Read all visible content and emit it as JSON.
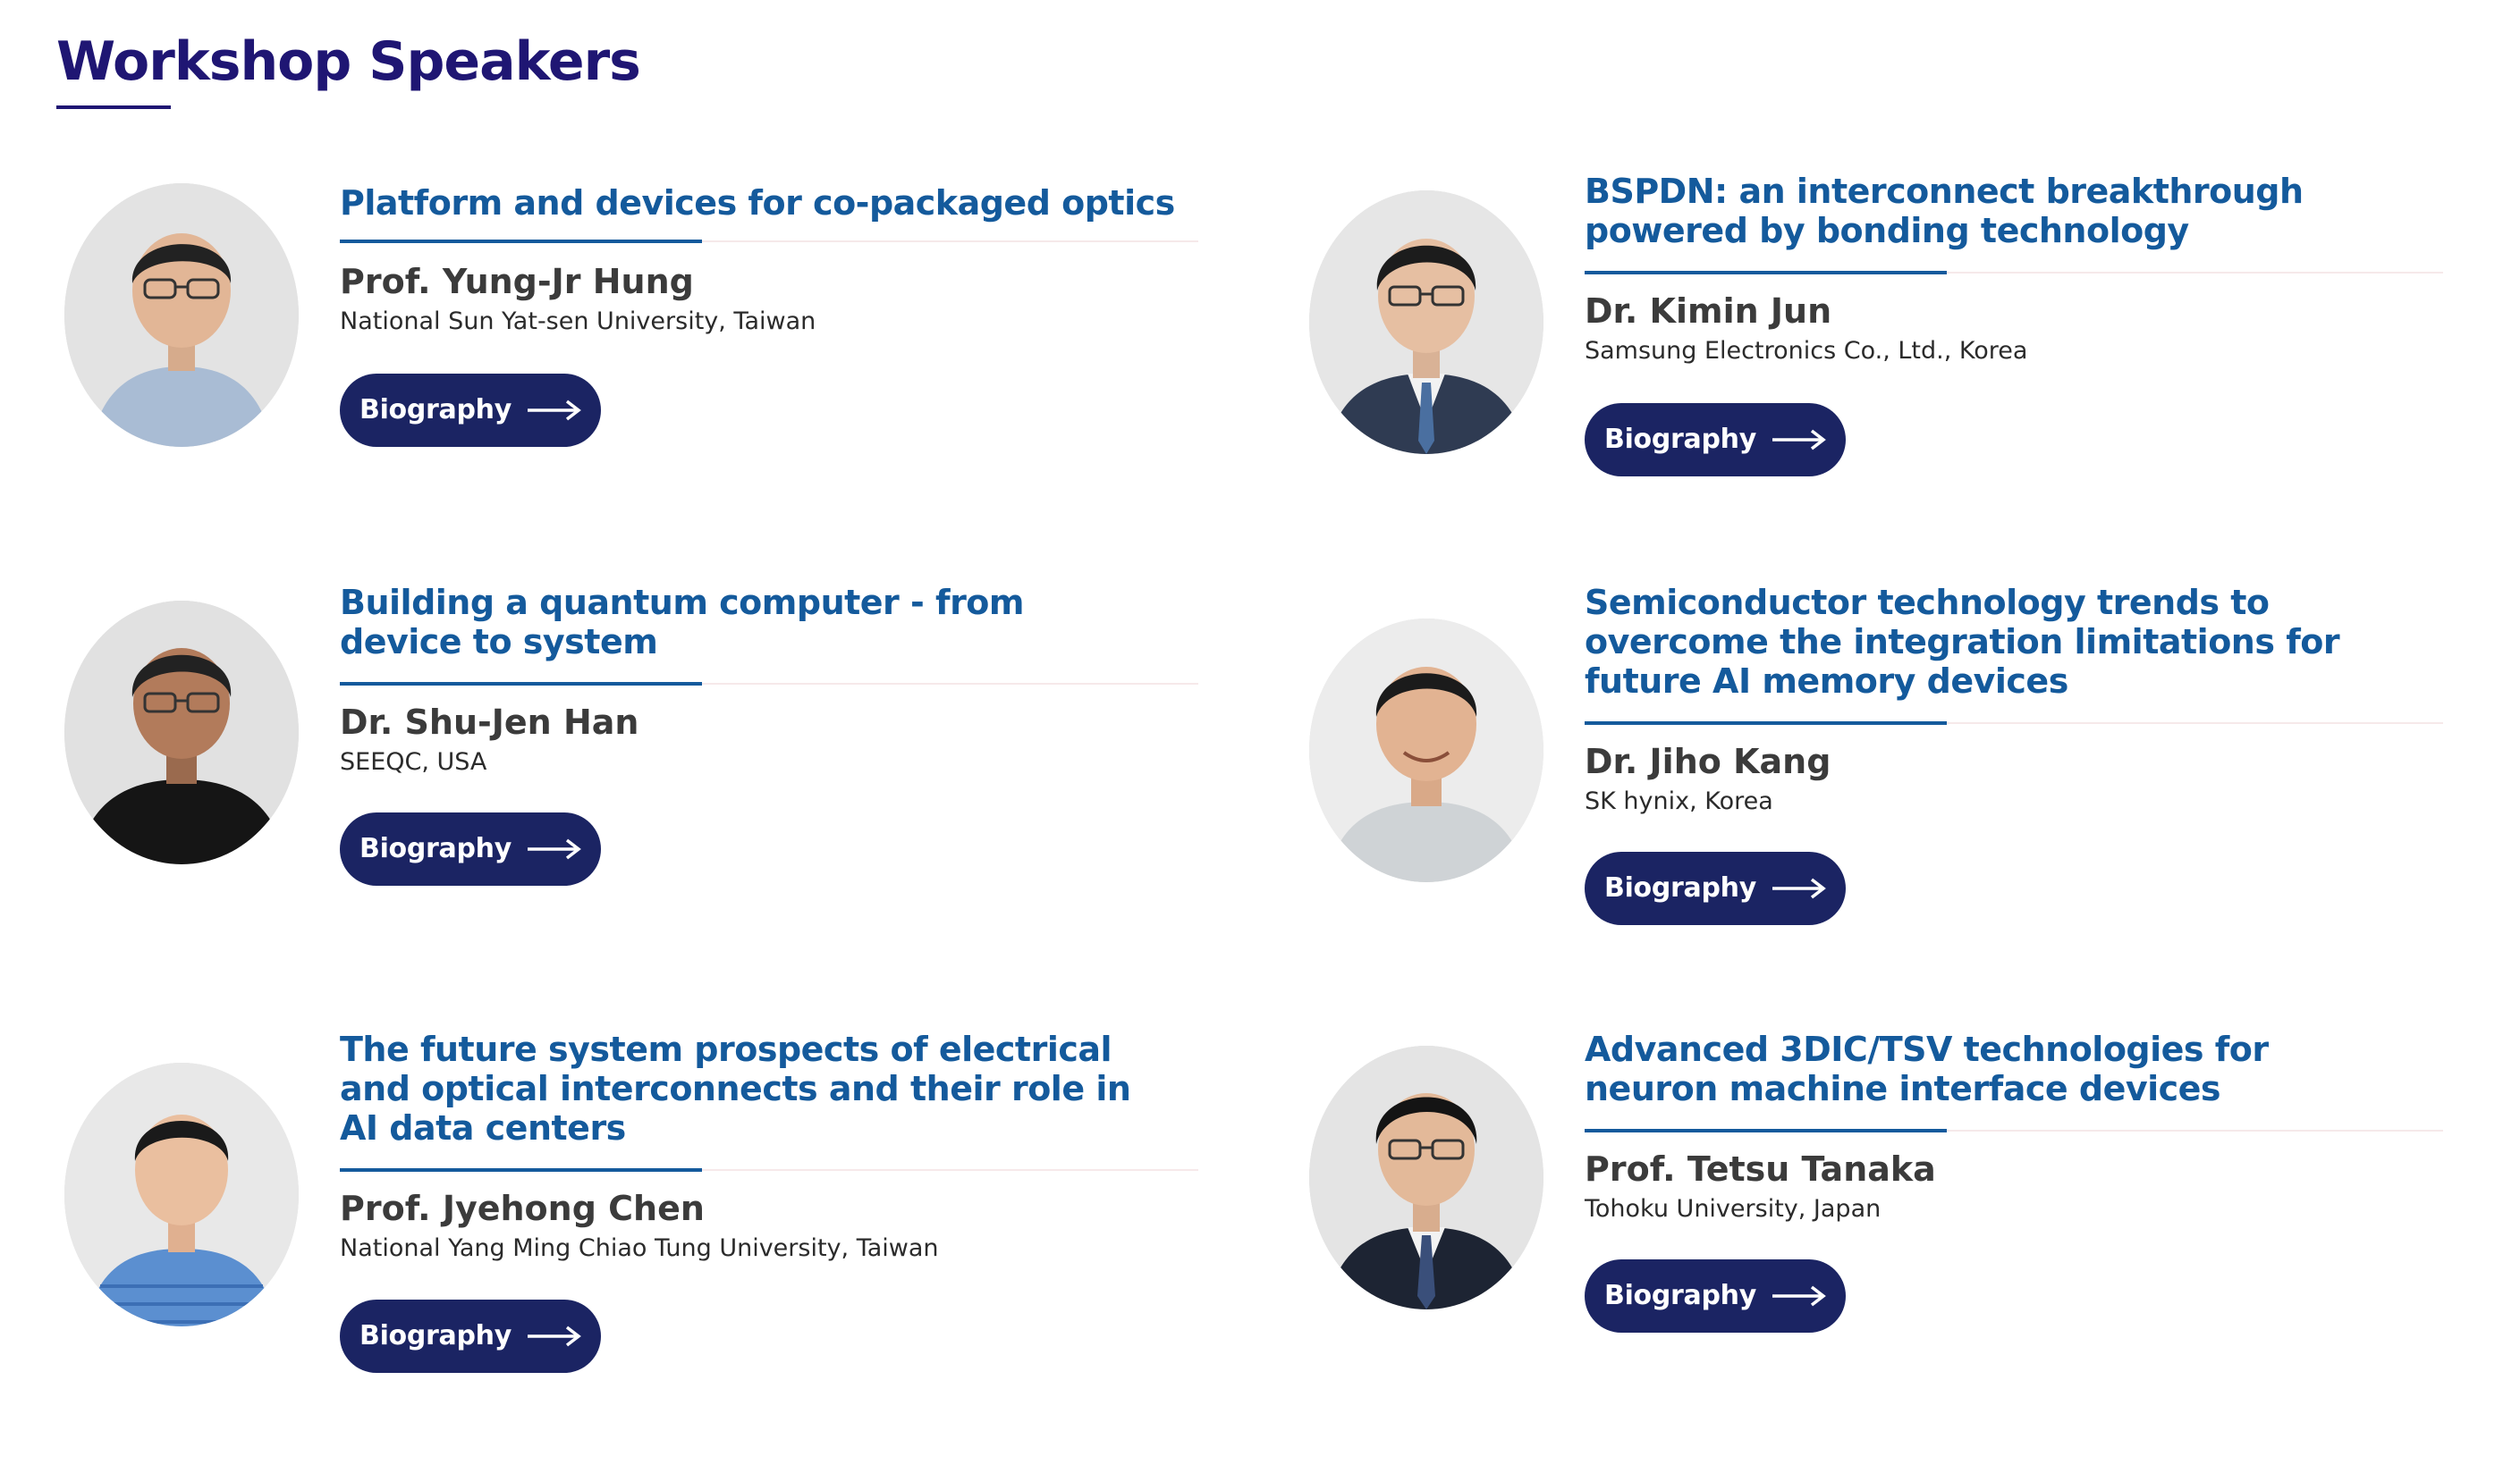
{
  "section": {
    "title": "Workshop Speakers"
  },
  "biography_label": "Biography",
  "speakers": [
    {
      "talk_title": "Platform and devices for co-packaged optics",
      "name": "Prof. Yung-Jr Hung",
      "affiliation": "National Sun Yat-sen University, Taiwan",
      "photo_icon": "portrait-photo"
    },
    {
      "talk_title": "BSPDN: an interconnect breakthrough powered by bonding technology",
      "name": "Dr. Kimin Jun",
      "affiliation": "Samsung Electronics Co., Ltd., Korea",
      "photo_icon": "portrait-photo"
    },
    {
      "talk_title": "Building a quantum computer - from device to system",
      "name": "Dr. Shu-Jen Han",
      "affiliation": "SEEQC, USA",
      "photo_icon": "portrait-photo"
    },
    {
      "talk_title": "Semiconductor technology trends to overcome the integration limitations for future AI memory devices",
      "name": "Dr. Jiho Kang",
      "affiliation": "SK hynix, Korea",
      "photo_icon": "portrait-photo"
    },
    {
      "talk_title": "The future system prospects of electrical and optical interconnects and their role in AI data centers",
      "name": "Prof. Jyehong Chen",
      "affiliation": "National Yang Ming Chiao Tung University, Taiwan",
      "photo_icon": "portrait-photo"
    },
    {
      "talk_title": "Advanced 3DIC/TSV technologies for neuron machine interface devices",
      "name": "Prof. Tetsu Tanaka",
      "affiliation": "Tohoku University, Japan",
      "photo_icon": "portrait-photo"
    }
  ],
  "colors": {
    "heading": "#1f1673",
    "talk_title": "#145a9c",
    "button": "#1b2463",
    "name": "#3b3b3b",
    "divider_light": "#f6e9ea"
  }
}
